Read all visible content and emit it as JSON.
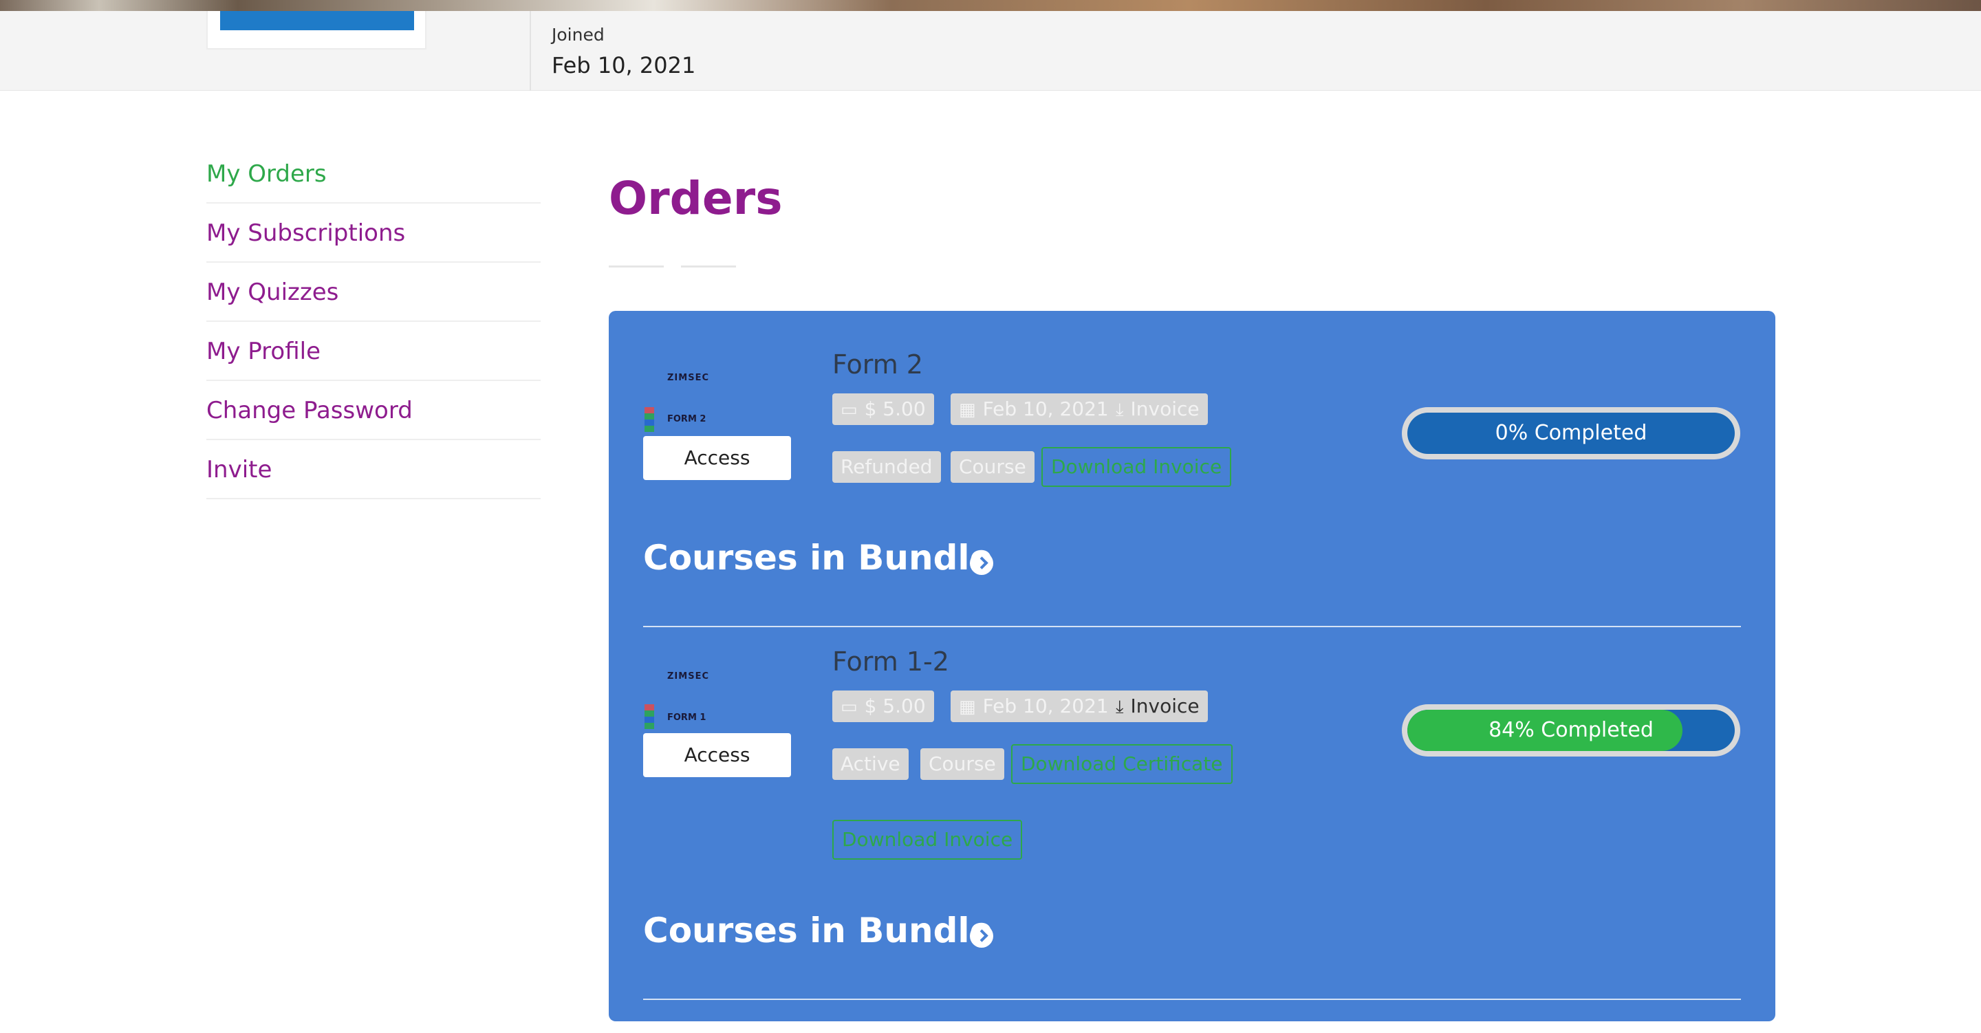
{
  "profile": {
    "joined_label": "Joined",
    "joined_date": "Feb 10, 2021"
  },
  "sidebar": {
    "items": [
      {
        "label": "My Orders",
        "active": true
      },
      {
        "label": "My Subscriptions",
        "active": false
      },
      {
        "label": "My Quizzes",
        "active": false
      },
      {
        "label": "My Profile",
        "active": false
      },
      {
        "label": "Change Password",
        "active": false
      },
      {
        "label": "Invite",
        "active": false
      }
    ]
  },
  "main": {
    "title": "Orders"
  },
  "orders": [
    {
      "thumb_top": "ZIMSEC",
      "thumb_mid": "FORM 2",
      "access_label": "Access",
      "title": "Form 2",
      "price": "$ 5.00",
      "date": "Feb 10, 2021",
      "invoice_label": "Invoice",
      "status": "Refunded",
      "type": "Course",
      "download_invoice": "Download Invoice",
      "progress_label": "0% Completed",
      "progress_percent": 0,
      "bundle_heading": "Courses in Bundle"
    },
    {
      "thumb_top": "ZIMSEC",
      "thumb_mid": "FORM 1",
      "access_label": "Access",
      "title": "Form 1-2",
      "price": "$ 5.00",
      "date": "Feb 10, 2021",
      "invoice_label": "Invoice",
      "status": "Active",
      "type": "Course",
      "download_certificate": "Download Certificate",
      "download_invoice": "Download Invoice",
      "progress_label": "84% Completed",
      "progress_percent": 84,
      "bundle_heading": "Courses in Bundle"
    }
  ],
  "colors": {
    "accent": "#8e1c8e",
    "active": "#2ea84a",
    "panel": "#4780d4",
    "progress_track": "#1a67b4",
    "progress_fill": "#2fb84a"
  },
  "icons": {
    "price": "money-icon",
    "date": "calendar-icon",
    "invoice": "download-icon",
    "bundle": "chevron-right-circle-icon"
  }
}
